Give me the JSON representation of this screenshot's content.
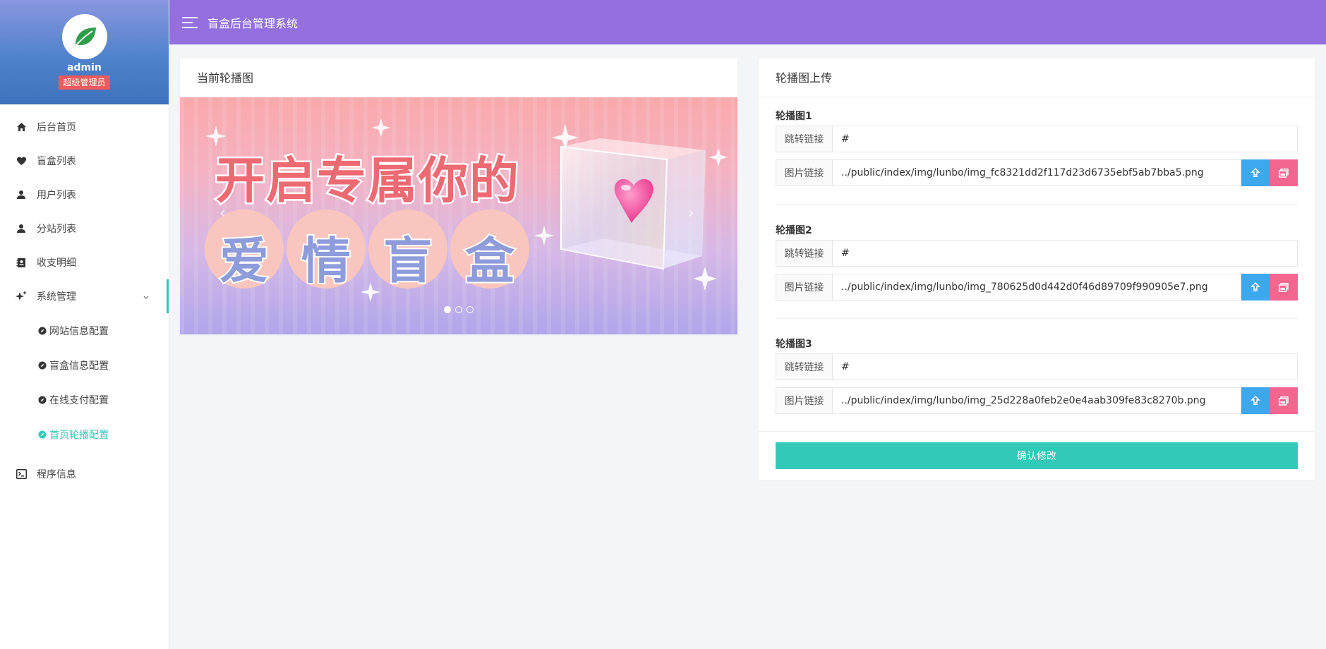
{
  "app": {
    "title": "盲盒后台管理系统"
  },
  "profile": {
    "name": "admin",
    "role": "超级管理员"
  },
  "menu": {
    "items": [
      {
        "label": "后台首页",
        "icon": "home-icon"
      },
      {
        "label": "盲盒列表",
        "icon": "heart-icon"
      },
      {
        "label": "用户列表",
        "icon": "user-icon"
      },
      {
        "label": "分站列表",
        "icon": "user-icon"
      },
      {
        "label": "收支明细",
        "icon": "contacts-icon"
      },
      {
        "label": "系统管理",
        "icon": "sparkle-icon"
      },
      {
        "label": "程序信息",
        "icon": "terminal-icon"
      }
    ],
    "submenu": [
      {
        "label": "网站信息配置"
      },
      {
        "label": "盲盒信息配置"
      },
      {
        "label": "在线支付配置"
      },
      {
        "label": "首页轮播配置"
      }
    ]
  },
  "left_card": {
    "title": "当前轮播图",
    "banner": {
      "line1": "开启专属你的",
      "line2": [
        "爱",
        "情",
        "盲",
        "盒"
      ],
      "active_slide": 1,
      "slide_count": 3
    }
  },
  "right_card": {
    "title": "轮播图上传",
    "groups": [
      {
        "title": "轮播图1",
        "link_label": "跳转链接",
        "link_value": "#",
        "image_label": "图片链接",
        "image_value": "../public/index/img/lunbo/img_fc8321dd2f117d23d6735ebf5ab7bba5.png"
      },
      {
        "title": "轮播图2",
        "link_label": "跳转链接",
        "link_value": "#",
        "image_label": "图片链接",
        "image_value": "../public/index/img/lunbo/img_780625d0d442d0f46d89709f990905e7.png"
      },
      {
        "title": "轮播图3",
        "link_label": "跳转链接",
        "link_value": "#",
        "image_label": "图片链接",
        "image_value": "../public/index/img/lunbo/img_25d228a0feb2e0e4aab309fe83c8270b.png"
      }
    ],
    "confirm_label": "确认修改"
  },
  "colors": {
    "topbar": "#9370de",
    "accent": "#33c9b9",
    "upload": "#3ea8ee",
    "picture": "#f26690",
    "badge": "#ef5a5a"
  }
}
